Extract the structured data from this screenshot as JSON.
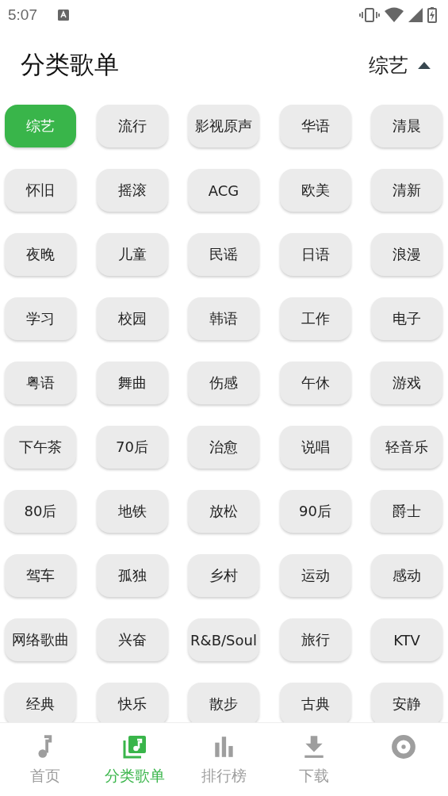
{
  "status_bar": {
    "time": "5:07"
  },
  "header": {
    "title": "分类歌单",
    "current": "综艺"
  },
  "categories": [
    {
      "label": "综艺",
      "selected": true
    },
    {
      "label": "流行",
      "selected": false
    },
    {
      "label": "影视原声",
      "selected": false
    },
    {
      "label": "华语",
      "selected": false
    },
    {
      "label": "清晨",
      "selected": false
    },
    {
      "label": "怀旧",
      "selected": false
    },
    {
      "label": "摇滚",
      "selected": false
    },
    {
      "label": "ACG",
      "selected": false
    },
    {
      "label": "欧美",
      "selected": false
    },
    {
      "label": "清新",
      "selected": false
    },
    {
      "label": "夜晚",
      "selected": false
    },
    {
      "label": "儿童",
      "selected": false
    },
    {
      "label": "民谣",
      "selected": false
    },
    {
      "label": "日语",
      "selected": false
    },
    {
      "label": "浪漫",
      "selected": false
    },
    {
      "label": "学习",
      "selected": false
    },
    {
      "label": "校园",
      "selected": false
    },
    {
      "label": "韩语",
      "selected": false
    },
    {
      "label": "工作",
      "selected": false
    },
    {
      "label": "电子",
      "selected": false
    },
    {
      "label": "粤语",
      "selected": false
    },
    {
      "label": "舞曲",
      "selected": false
    },
    {
      "label": "伤感",
      "selected": false
    },
    {
      "label": "午休",
      "selected": false
    },
    {
      "label": "游戏",
      "selected": false
    },
    {
      "label": "下午茶",
      "selected": false
    },
    {
      "label": "70后",
      "selected": false
    },
    {
      "label": "治愈",
      "selected": false
    },
    {
      "label": "说唱",
      "selected": false
    },
    {
      "label": "轻音乐",
      "selected": false
    },
    {
      "label": "80后",
      "selected": false
    },
    {
      "label": "地铁",
      "selected": false
    },
    {
      "label": "放松",
      "selected": false
    },
    {
      "label": "90后",
      "selected": false
    },
    {
      "label": "爵士",
      "selected": false
    },
    {
      "label": "驾车",
      "selected": false
    },
    {
      "label": "孤独",
      "selected": false
    },
    {
      "label": "乡村",
      "selected": false
    },
    {
      "label": "运动",
      "selected": false
    },
    {
      "label": "感动",
      "selected": false
    },
    {
      "label": "网络歌曲",
      "selected": false
    },
    {
      "label": "兴奋",
      "selected": false
    },
    {
      "label": "R&B/Soul",
      "selected": false
    },
    {
      "label": "旅行",
      "selected": false
    },
    {
      "label": "KTV",
      "selected": false
    },
    {
      "label": "经典",
      "selected": false
    },
    {
      "label": "快乐",
      "selected": false
    },
    {
      "label": "散步",
      "selected": false
    },
    {
      "label": "古典",
      "selected": false
    },
    {
      "label": "安静",
      "selected": false
    }
  ],
  "bottom_nav": [
    {
      "kind": "note",
      "label": "首页",
      "selected": false
    },
    {
      "kind": "playlist",
      "label": "分类歌单",
      "selected": true
    },
    {
      "kind": "chart",
      "label": "排行榜",
      "selected": false
    },
    {
      "kind": "download",
      "label": "下载",
      "selected": false
    },
    {
      "kind": "disc",
      "selected": false
    }
  ]
}
